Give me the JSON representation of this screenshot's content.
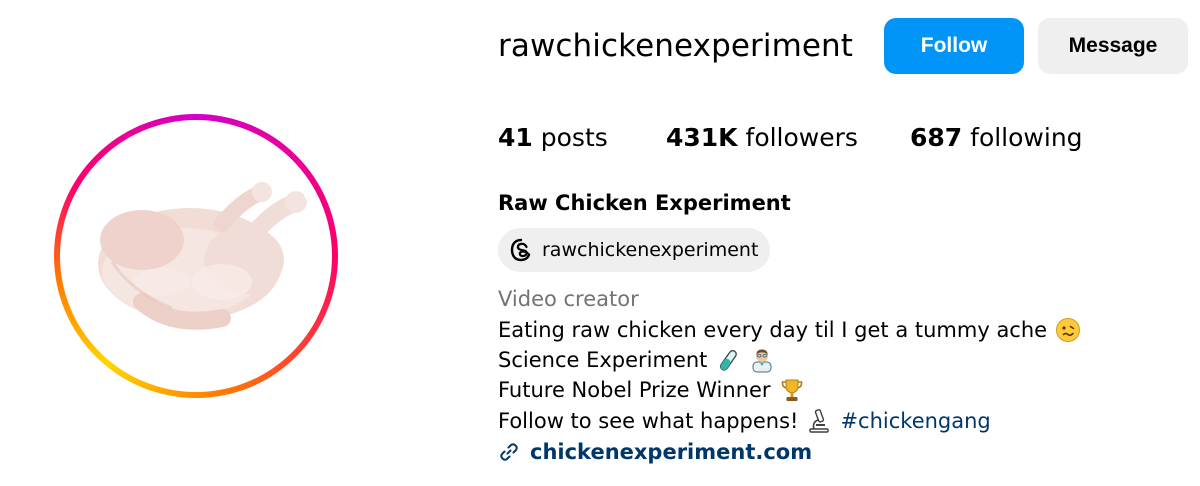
{
  "profile": {
    "username": "rawchickenexperiment",
    "full_name": "Raw Chicken Experiment",
    "avatar_subject": "raw whole chicken"
  },
  "actions": {
    "follow_label": "Follow",
    "message_label": "Message"
  },
  "stats": {
    "posts_count": "41",
    "posts_label": "posts",
    "followers_count": "431K",
    "followers_label": "followers",
    "following_count": "687",
    "following_label": "following"
  },
  "threads": {
    "handle": "rawchickenexperiment",
    "icon": "threads-icon"
  },
  "bio": {
    "category": "Video creator",
    "line1": "Eating raw chicken every day til I get a tummy ache",
    "line1_emoji": "woozy-face-icon",
    "line2": "Science Experiment",
    "line2_emojis": [
      "test-tube-icon",
      "scientist-icon"
    ],
    "line3": "Future Nobel Prize Winner",
    "line3_emoji": "trophy-icon",
    "line4": "Follow to see what happens!",
    "line4_emoji": "microscope-icon",
    "hashtag": "#chickengang"
  },
  "website": {
    "url_text": "chickenexperiment.com",
    "icon": "link-icon"
  },
  "colors": {
    "follow_button": "#0095f6",
    "message_button": "#efefef",
    "link": "#00376b",
    "category": "#737373"
  }
}
